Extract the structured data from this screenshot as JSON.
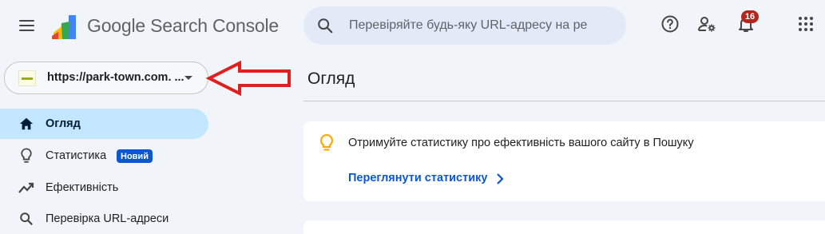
{
  "header": {
    "product_name": "Google Search Console",
    "search_placeholder": "Перевіряйте будь-яку URL-адресу на ре",
    "notifications_count": "16",
    "icons": {
      "menu": "menu-icon",
      "logo": "search-console-logo",
      "search": "search-icon",
      "help": "help-icon",
      "users": "manage-users-icon",
      "bell": "notifications-icon",
      "apps": "apps-grid-icon"
    }
  },
  "property_selector": {
    "url": "https://park-town.com. ...",
    "icon": "site-favicon"
  },
  "page": {
    "title": "Огляд"
  },
  "sidebar": {
    "items": [
      {
        "label": "Огляд",
        "icon": "home-icon",
        "active": true
      },
      {
        "label": "Статистика",
        "icon": "lightbulb-icon",
        "badge": "Новий"
      },
      {
        "label": "Ефективність",
        "icon": "trending-up-icon"
      },
      {
        "label": "Перевірка URL-адреси",
        "icon": "search-icon"
      }
    ]
  },
  "insights_card": {
    "text": "Отримуйте статистику про ефективність вашого сайту в Пошуку",
    "link_label": "Переглянути статистику",
    "icon": "lightbulb-icon"
  },
  "colors": {
    "background": "#f1f4f9",
    "active_nav": "#c2e7ff",
    "link": "#0b57d0",
    "badge_red": "#b3261e",
    "annotation_arrow": "#e0201e"
  }
}
